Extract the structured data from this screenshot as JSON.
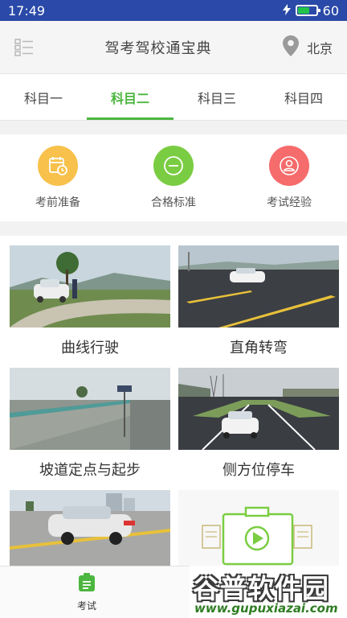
{
  "status_bar": {
    "time": "17:49",
    "battery_level": "60",
    "battery_fraction": 0.6
  },
  "header": {
    "title": "驾考驾校通宝典",
    "location": "北京"
  },
  "tabs": [
    {
      "label": "科目一",
      "active": false
    },
    {
      "label": "科目二",
      "active": true
    },
    {
      "label": "科目三",
      "active": false
    },
    {
      "label": "科目四",
      "active": false
    }
  ],
  "quick_actions": [
    {
      "label": "考前准备",
      "color": "#f7c14b",
      "icon": "calendar-clock-icon"
    },
    {
      "label": "合格标准",
      "color": "#7acd42",
      "icon": "minus-circle-icon"
    },
    {
      "label": "考试经验",
      "color": "#f66b6b",
      "icon": "user-icon"
    }
  ],
  "lessons": [
    {
      "label": "曲线行驶"
    },
    {
      "label": "直角转弯"
    },
    {
      "label": "坡道定点与起步"
    },
    {
      "label": "侧方位停车"
    },
    {
      "label": ""
    },
    {
      "label": ""
    }
  ],
  "bottom_nav": {
    "exam_label": "考试"
  },
  "watermark": {
    "brand": "谷普软件园",
    "url": "www.gupuxiazai.com"
  },
  "colors": {
    "accent": "#4cb63f",
    "status_bar": "#2a49a8"
  }
}
